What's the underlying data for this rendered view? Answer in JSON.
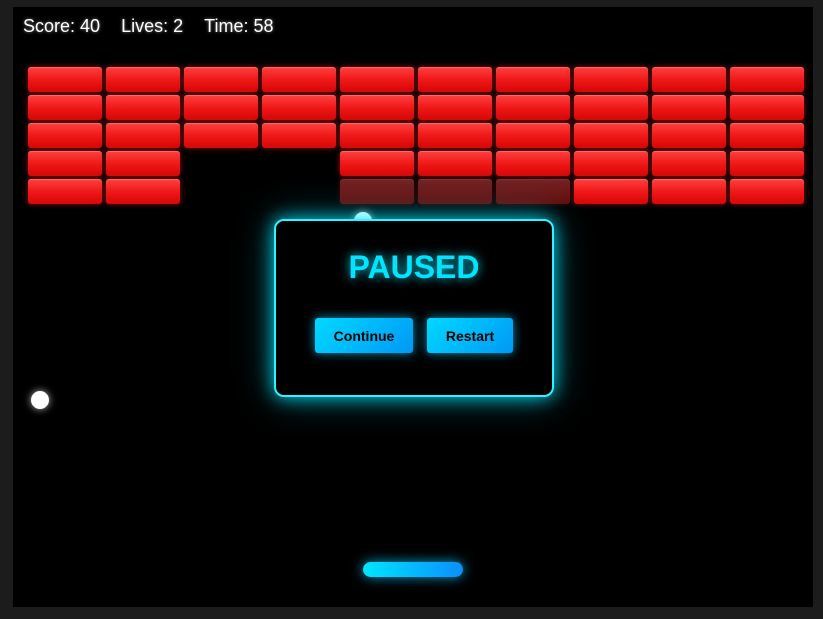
{
  "hud": {
    "score_label": "Score: 40",
    "lives_label": "Lives: 2",
    "time_label": "Time: 58"
  },
  "bricks": {
    "grid_rows": 5,
    "grid_cols": 10,
    "present": [
      [
        1,
        1,
        1,
        1,
        1,
        1,
        1,
        1,
        1,
        1
      ],
      [
        1,
        1,
        1,
        1,
        1,
        1,
        1,
        1,
        1,
        1
      ],
      [
        1,
        1,
        1,
        1,
        1,
        1,
        1,
        1,
        1,
        1
      ],
      [
        1,
        1,
        0,
        0,
        1,
        1,
        1,
        1,
        1,
        1
      ],
      [
        1,
        1,
        0,
        0,
        1,
        1,
        1,
        1,
        1,
        1
      ]
    ],
    "damaged": [
      [
        0,
        0,
        0,
        0,
        0,
        0,
        0,
        0,
        0,
        0
      ],
      [
        0,
        0,
        0,
        0,
        0,
        0,
        0,
        0,
        0,
        0
      ],
      [
        0,
        0,
        0,
        0,
        0,
        0,
        0,
        0,
        0,
        0
      ],
      [
        0,
        0,
        0,
        0,
        0,
        0,
        0,
        0,
        0,
        0
      ],
      [
        0,
        0,
        0,
        0,
        1,
        1,
        1,
        0,
        0,
        0
      ]
    ],
    "color": "#ff2020"
  },
  "balls_count": 2,
  "overlay": {
    "title": "PAUSED",
    "continue_label": "Continue",
    "restart_label": "Restart",
    "accent_color": "#00e5ff"
  },
  "colors": {
    "background": "#000000",
    "frame": "#1c1c1c",
    "paddle": "#00c8ff",
    "brick": "#ff2020"
  }
}
